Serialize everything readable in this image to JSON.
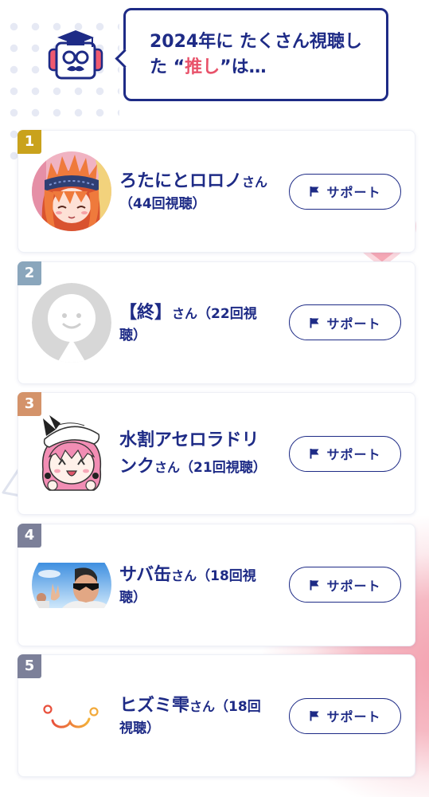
{
  "header": {
    "mascot_icon": "robot-mascot-icon",
    "bubble": {
      "line1": "2024年に たくさん視聴し",
      "line2_before": "た “",
      "highlight": "推し",
      "line2_after": "”は…"
    }
  },
  "ranking": [
    {
      "rank": "1",
      "name": "ろたにとロロノ",
      "honorific": "さん",
      "views": "（44回視聴）",
      "avatar": "anime-girl-avatar",
      "support_label": "サポート",
      "support_icon": "flag-icon"
    },
    {
      "rank": "2",
      "name": "【終】",
      "honorific": "さん",
      "views": "（22回視聴）",
      "avatar": "default-user-avatar",
      "support_label": "サポート",
      "support_icon": "flag-icon"
    },
    {
      "rank": "3",
      "name": "水割アセロラドリンク",
      "honorific": "さん",
      "views": "（21回視聴）",
      "avatar": "chibi-girl-avatar",
      "support_label": "サポート",
      "support_icon": "flag-icon"
    },
    {
      "rank": "4",
      "name": "サバ缶",
      "honorific": "さん",
      "views": "（18回視聴）",
      "avatar": "photo-avatar",
      "support_label": "サポート",
      "support_icon": "flag-icon"
    },
    {
      "rank": "5",
      "name": "ヒズミ雫",
      "honorific": "さん",
      "views": "（18回視聴）",
      "avatar": "emoticon-face-avatar",
      "support_label": "サポート",
      "support_icon": "flag-icon"
    }
  ],
  "colors": {
    "navy": "#1e2b86",
    "highlight": "#e8526a",
    "rank_badges": [
      "#c9a21c",
      "#8aa6bc",
      "#d4936a",
      "#7c8099",
      "#7c8099"
    ]
  }
}
